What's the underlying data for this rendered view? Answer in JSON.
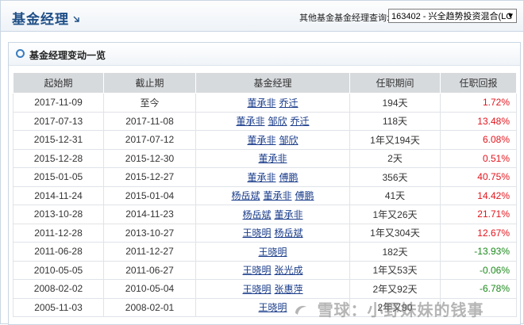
{
  "header": {
    "title": "基金经理",
    "selector_label": "其他基金基金经理查询:",
    "selector_value": "163402 - 兴全趋势投资混合(LC"
  },
  "section": {
    "title": "基金经理变动一览"
  },
  "table": {
    "columns": [
      "起始期",
      "截止期",
      "基金经理",
      "任职期间",
      "任职回报"
    ],
    "rows": [
      {
        "start": "2017-11-09",
        "end": "至今",
        "managers": [
          "董承非",
          "乔迁"
        ],
        "tenure": "194天",
        "return": "1.72%",
        "dir": "up"
      },
      {
        "start": "2017-07-13",
        "end": "2017-11-08",
        "managers": [
          "董承非",
          "邹欣",
          "乔迁"
        ],
        "tenure": "118天",
        "return": "13.48%",
        "dir": "up"
      },
      {
        "start": "2015-12-31",
        "end": "2017-07-12",
        "managers": [
          "董承非",
          "邹欣"
        ],
        "tenure": "1年又194天",
        "return": "6.08%",
        "dir": "up"
      },
      {
        "start": "2015-12-28",
        "end": "2015-12-30",
        "managers": [
          "董承非"
        ],
        "tenure": "2天",
        "return": "0.51%",
        "dir": "up"
      },
      {
        "start": "2015-01-05",
        "end": "2015-12-27",
        "managers": [
          "董承非",
          "傅鹏"
        ],
        "tenure": "356天",
        "return": "40.75%",
        "dir": "up"
      },
      {
        "start": "2014-11-24",
        "end": "2015-01-04",
        "managers": [
          "杨岳斌",
          "董承非",
          "傅鹏"
        ],
        "tenure": "41天",
        "return": "14.42%",
        "dir": "up"
      },
      {
        "start": "2013-10-28",
        "end": "2014-11-23",
        "managers": [
          "杨岳斌",
          "董承非"
        ],
        "tenure": "1年又26天",
        "return": "21.71%",
        "dir": "up"
      },
      {
        "start": "2011-12-28",
        "end": "2013-10-27",
        "managers": [
          "王晓明",
          "杨岳斌"
        ],
        "tenure": "1年又304天",
        "return": "12.67%",
        "dir": "up"
      },
      {
        "start": "2011-06-28",
        "end": "2011-12-27",
        "managers": [
          "王晓明"
        ],
        "tenure": "182天",
        "return": "-13.93%",
        "dir": "down"
      },
      {
        "start": "2010-05-05",
        "end": "2011-06-27",
        "managers": [
          "王晓明",
          "张光成"
        ],
        "tenure": "1年又53天",
        "return": "-0.06%",
        "dir": "down"
      },
      {
        "start": "2008-02-02",
        "end": "2010-05-04",
        "managers": [
          "王晓明",
          "张惠萍"
        ],
        "tenure": "2年又92天",
        "return": "-6.78%",
        "dir": "down"
      },
      {
        "start": "2005-11-03",
        "end": "2008-02-01",
        "managers": [
          "王晓明"
        ],
        "tenure": "2年又90",
        "return": "",
        "dir": "up"
      }
    ]
  },
  "watermark": {
    "text": "雪球：小野妹妹的钱事"
  },
  "colors": {
    "up": "#e3141c",
    "down": "#1b8a1b",
    "link": "#1a3c8a",
    "title": "#1f4f87"
  }
}
